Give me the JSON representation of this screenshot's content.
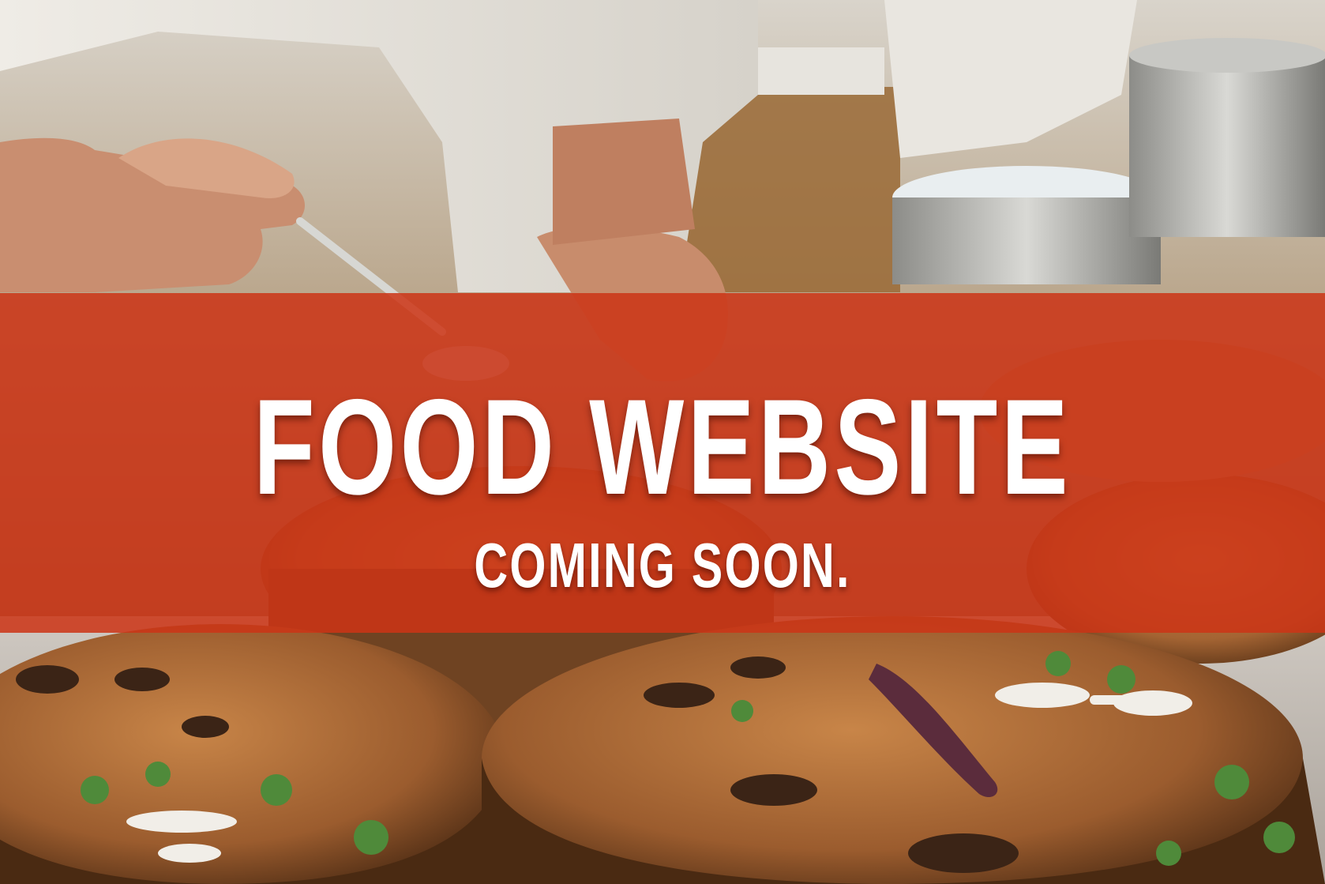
{
  "banner": {
    "title": "FOOD WEBSITE",
    "subtitle": "COMING SOON.",
    "overlay_color": "#cc3416",
    "text_color": "#ffffff"
  },
  "background": {
    "scene": "chef-plating-dishes-photo"
  }
}
